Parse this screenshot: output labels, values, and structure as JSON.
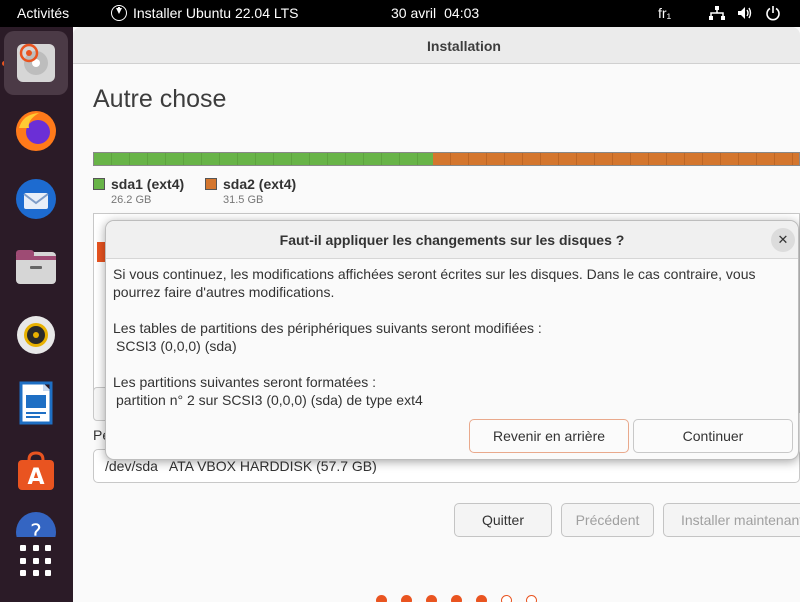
{
  "topbar": {
    "activities": "Activités",
    "app_name": "Installer Ubuntu 22.04 LTS",
    "date": "30 avril",
    "time": "04:03",
    "keyboard": "fr₁"
  },
  "dock": {
    "items": [
      {
        "name": "ubiquity-installer-icon",
        "active": true
      },
      {
        "name": "firefox-icon"
      },
      {
        "name": "thunderbird-icon"
      },
      {
        "name": "files-icon"
      },
      {
        "name": "rhythmbox-icon"
      },
      {
        "name": "libreoffice-writer-icon"
      },
      {
        "name": "software-center-icon"
      },
      {
        "name": "help-icon"
      }
    ]
  },
  "window": {
    "title": "Installation",
    "heading": "Autre chose",
    "partitions": [
      {
        "label": "sda1 (ext4)",
        "size": "26.2 GB",
        "color": "#68b448"
      },
      {
        "label": "sda2 (ext4)",
        "size": "31.5 GB",
        "color": "#d4762e"
      }
    ],
    "bootloader_label": "Pe",
    "device_select": "/dev/sda   ATA VBOX HARDDISK (57.7 GB)",
    "buttons": {
      "quit": "Quitter",
      "previous": "Précédent",
      "install": "Installer maintenant"
    },
    "progress": {
      "filled": 5,
      "total": 7
    }
  },
  "dialog": {
    "title": "Faut-il appliquer les changements sur les disques ?",
    "close": "✕",
    "p1": "Si vous continuez, les modifications affichées seront écrites sur les disques. Dans le cas contraire, vous pourrez faire d'autres modifications.",
    "p2_title": "Les tables de partitions des périphériques suivants seront modifiées :",
    "p2_item": "SCSI3 (0,0,0) (sda)",
    "p3_title": "Les partitions suivantes seront formatées :",
    "p3_item": "partition n° 2 sur SCSI3 (0,0,0) (sda) de type ext4",
    "back_button": "Revenir en arrière",
    "continue_button": "Continuer"
  },
  "colors": {
    "accent": "#e95420",
    "ext4_primary": "#68b448",
    "ext4_secondary": "#d4762e"
  }
}
